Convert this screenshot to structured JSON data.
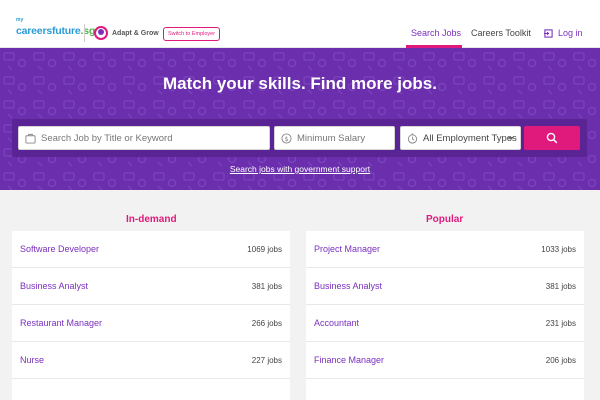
{
  "header": {
    "logo_prefix": "my",
    "logo_main": "careersfuture",
    "logo_suffix": ".sg",
    "partner_label": "Adapt & Grow",
    "switch_label": "Switch to Employer",
    "nav": [
      {
        "label": "Search Jobs",
        "active": true
      },
      {
        "label": "Careers Toolkit",
        "active": false
      },
      {
        "label": "Log in",
        "active": false
      }
    ]
  },
  "hero": {
    "title": "Match your skills. Find more jobs.",
    "keyword_placeholder": "Search Job by Title or Keyword",
    "salary_placeholder": "Minimum Salary",
    "employment_type": "All Employment Types",
    "gov_link": "Search jobs with government support"
  },
  "lists": {
    "in_demand_title": "In-demand",
    "popular_title": "Popular",
    "in_demand": [
      {
        "name": "Software Developer",
        "count": "1069 jobs"
      },
      {
        "name": "Business Analyst",
        "count": "381 jobs"
      },
      {
        "name": "Restaurant Manager",
        "count": "266 jobs"
      },
      {
        "name": "Nurse",
        "count": "227 jobs"
      }
    ],
    "popular": [
      {
        "name": "Project Manager",
        "count": "1033 jobs"
      },
      {
        "name": "Business Analyst",
        "count": "381 jobs"
      },
      {
        "name": "Accountant",
        "count": "231 jobs"
      },
      {
        "name": "Finance Manager",
        "count": "206 jobs"
      }
    ]
  },
  "colors": {
    "brand_purple": "#7b2fbe",
    "hero_purple": "#6b2fad",
    "accent_pink": "#e0197d",
    "logo_blue": "#2b9bd3"
  },
  "icons": {
    "keyword": "briefcase-icon",
    "salary": "dollar-icon",
    "type": "clock-icon",
    "search": "search-icon",
    "login": "login-icon"
  }
}
